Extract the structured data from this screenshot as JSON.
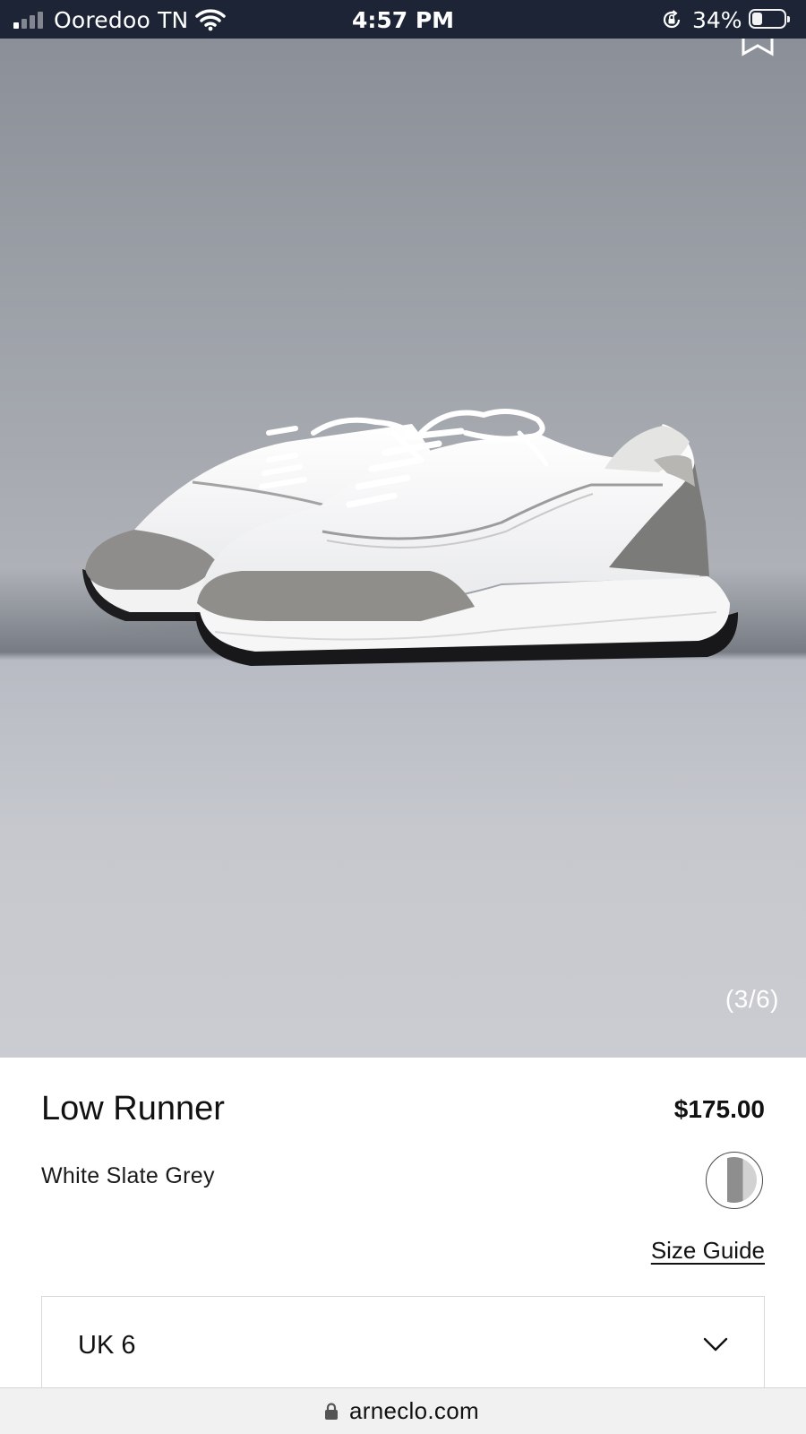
{
  "status_bar": {
    "carrier": "Ooredoo TN",
    "time": "4:57 PM",
    "battery": "34%",
    "signal_bars_active": 1,
    "icons": [
      "signal-icon",
      "wifi-icon",
      "rotation-lock-icon",
      "battery-icon"
    ]
  },
  "gallery": {
    "counter": "(3/6)",
    "icons": [
      "bookmark-icon"
    ]
  },
  "product": {
    "name": "Low Runner",
    "price": "$175.00",
    "color": "White Slate Grey",
    "swatch_colors": [
      "#ffffff",
      "#8e8e8e",
      "#d2d2d2"
    ]
  },
  "size": {
    "guide_label": "Size Guide",
    "selected": "UK 6"
  },
  "browser": {
    "url": "arneclo.com"
  },
  "colors": {
    "status_bar_bg": "#1c2436",
    "page_bg": "#ffffff",
    "url_bar_bg": "#f1f1f1"
  }
}
